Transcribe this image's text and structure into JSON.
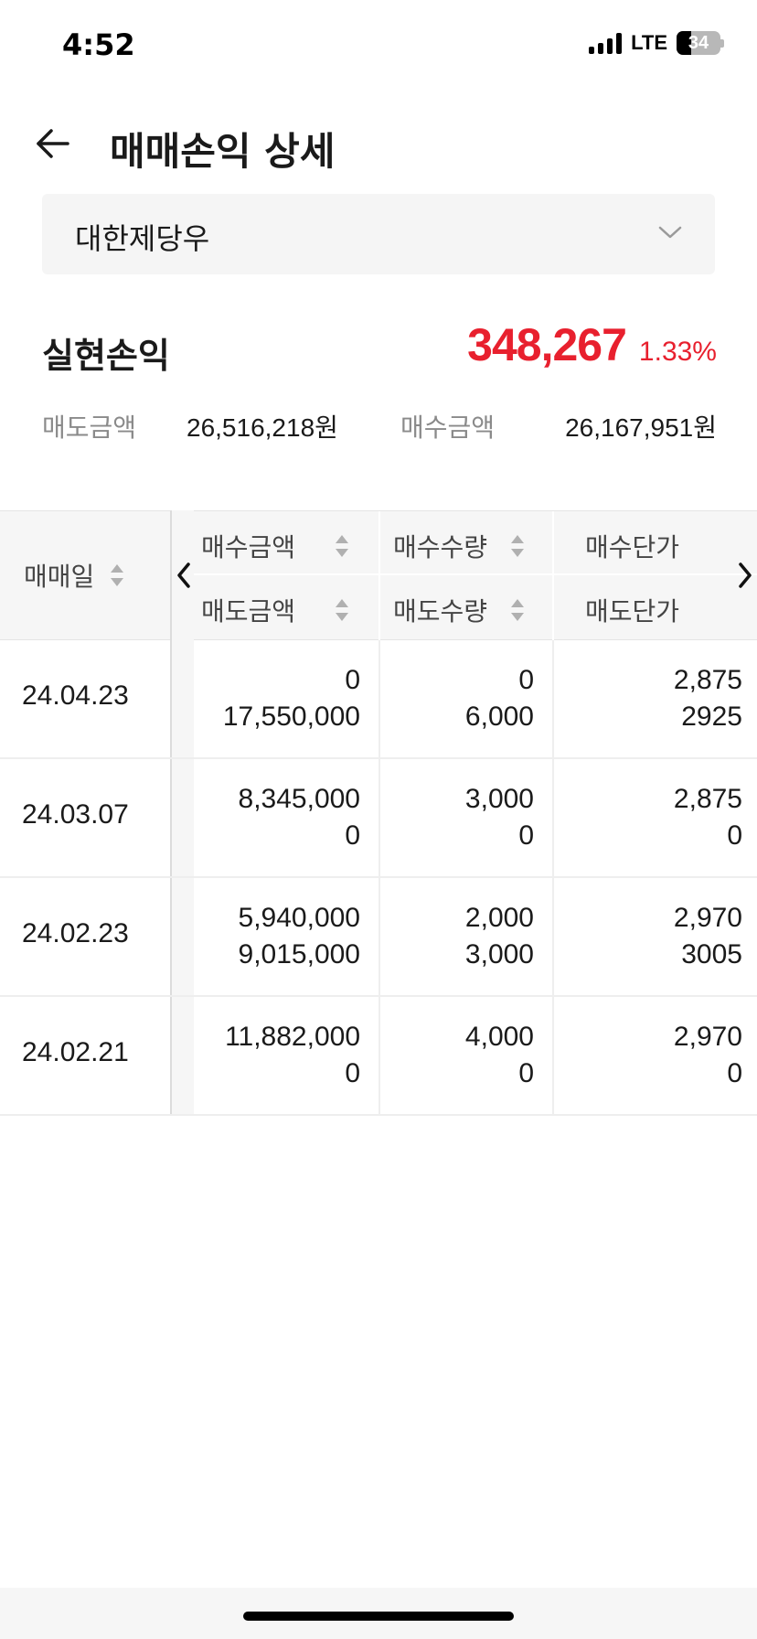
{
  "status_bar": {
    "time": "4:52",
    "network": "LTE",
    "battery": "34"
  },
  "header": {
    "title": "매매손익 상세"
  },
  "stock_select": {
    "value": "대한제당우"
  },
  "summary": {
    "realized_label": "실현손익",
    "realized_value": "348,267",
    "realized_rate": "1.33%",
    "sell_amount_label": "매도금액",
    "sell_amount": "26,516,218원",
    "buy_amount_label": "매수금액",
    "buy_amount": "26,167,951원"
  },
  "table": {
    "headers": {
      "date": "매매일",
      "buy_amount": "매수금액",
      "sell_amount": "매도금액",
      "buy_qty": "매수수량",
      "sell_qty": "매도수량",
      "buy_price": "매수단가",
      "sell_price": "매도단가"
    },
    "rows": [
      {
        "date": "24.04.23",
        "buy_amount": "0",
        "sell_amount": "17,550,000",
        "buy_qty": "0",
        "sell_qty": "6,000",
        "buy_price": "2,875",
        "sell_price": "2925"
      },
      {
        "date": "24.03.07",
        "buy_amount": "8,345,000",
        "sell_amount": "0",
        "buy_qty": "3,000",
        "sell_qty": "0",
        "buy_price": "2,875",
        "sell_price": "0"
      },
      {
        "date": "24.02.23",
        "buy_amount": "5,940,000",
        "sell_amount": "9,015,000",
        "buy_qty": "2,000",
        "sell_qty": "3,000",
        "buy_price": "2,970",
        "sell_price": "3005"
      },
      {
        "date": "24.02.21",
        "buy_amount": "11,882,000",
        "sell_amount": "0",
        "buy_qty": "4,000",
        "sell_qty": "0",
        "buy_price": "2,970",
        "sell_price": "0"
      }
    ]
  },
  "colors": {
    "accent_red": "#e8202e",
    "muted_text": "#8a8a8a",
    "header_bg": "#f6f6f6"
  }
}
